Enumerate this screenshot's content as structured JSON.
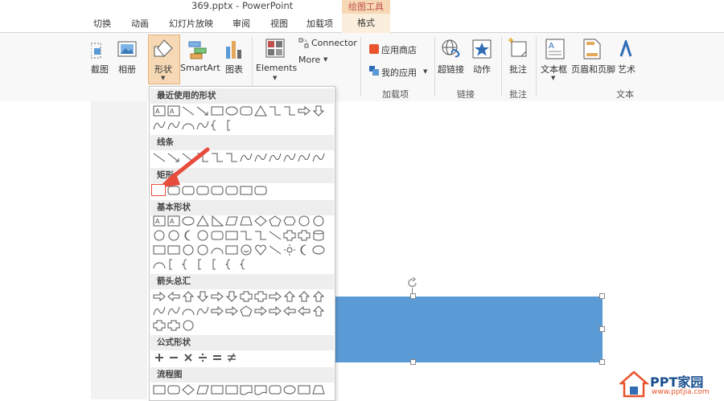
{
  "title_bar": {
    "title": "369.pptx - PowerPoint",
    "context_group": "绘图工具"
  },
  "tabs": [
    "切换",
    "动画",
    "幻灯片放映",
    "审阅",
    "视图",
    "加载项",
    "格式"
  ],
  "ribbon": {
    "buttons": {
      "screenshot": "截图",
      "album": "相册",
      "shapes": "形状",
      "smartart": "SmartArt",
      "chart": "图表",
      "elements": "Elements",
      "connector": "Connector",
      "more": "More",
      "store": "应用商店",
      "my_apps": "我的应用",
      "hyperlink": "超链接",
      "action": "动作",
      "comment": "批注",
      "textbox": "文本框",
      "header_footer": "页眉和页脚",
      "wordart": "艺术"
    },
    "groups": {
      "addins": "加载项",
      "links": "链接",
      "comments": "批注",
      "text": "文本"
    }
  },
  "dropdown": {
    "categories": [
      "最近使用的形状",
      "线条",
      "矩形",
      "基本形状",
      "箭头总汇",
      "公式形状",
      "流程图"
    ]
  },
  "colors": {
    "shape_fill": "#5b9bd5",
    "accent_orange": "#c0504d",
    "arrow_red": "#e74c3c",
    "context_tab": "#f6d9b4"
  },
  "watermark": {
    "brand": "PPT家园",
    "url": "www.pptjia.com"
  }
}
